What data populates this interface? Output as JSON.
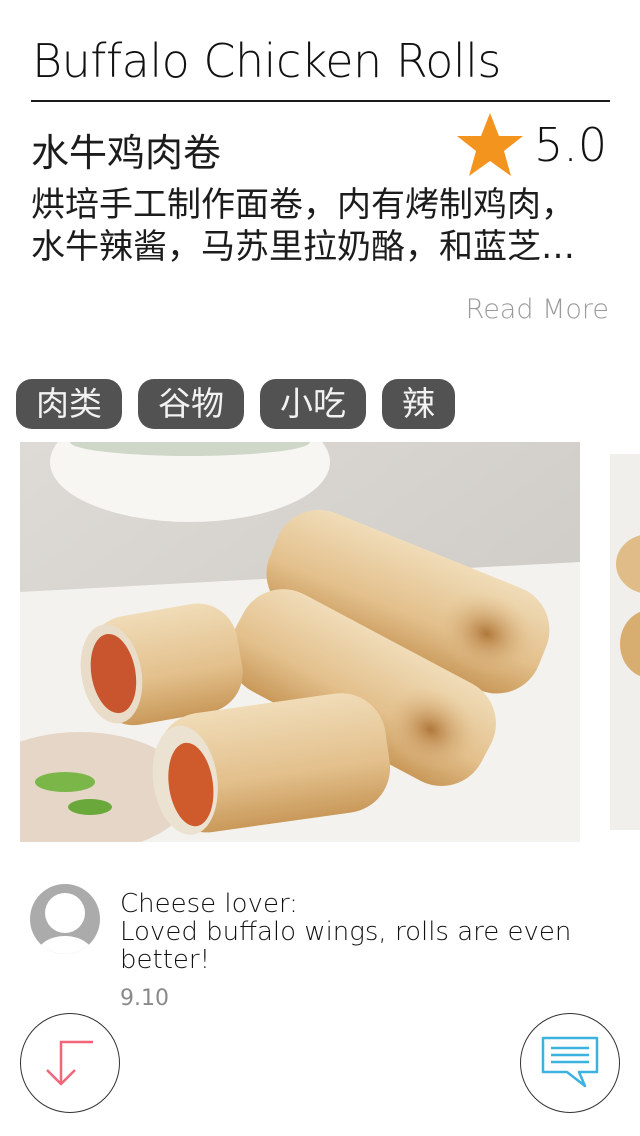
{
  "recipe": {
    "title": "Buffalo Chicken Rolls",
    "subtitle": "水牛鸡肉卷",
    "rating": "5.0",
    "description_line1": "烘培手工制作面卷，内有烤制鸡肉，",
    "description_line2": "水牛辣酱，马苏里拉奶酪，和蓝芝…",
    "read_more": "Read More"
  },
  "tags": [
    "肉类",
    "谷物",
    "小吃",
    "辣"
  ],
  "comment": {
    "author": "Cheese lover:",
    "text": "Loved buffalo wings, rolls are even better!",
    "date": "9.10"
  },
  "icons": {
    "star": "star-icon",
    "avatar": "user-avatar-icon",
    "left_fab": "arrow-down-icon",
    "right_fab": "comment-icon"
  },
  "colors": {
    "star": "#F3941F",
    "tag_bg": "#525252",
    "arrow": "#F2667A",
    "comment_icon": "#3DB2DE"
  }
}
